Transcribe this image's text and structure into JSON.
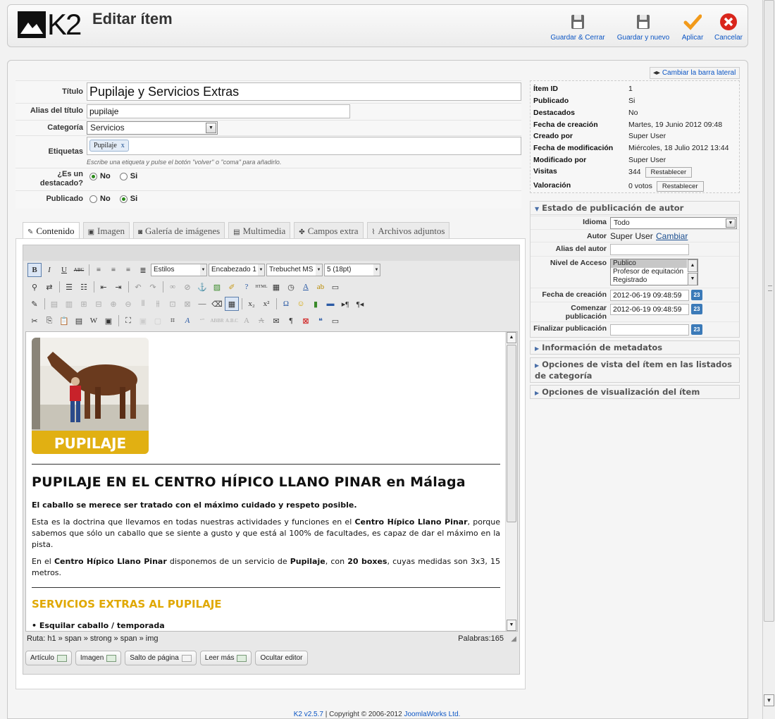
{
  "header": {
    "title": "Editar ítem",
    "logo_text": "K2",
    "buttons": [
      {
        "label": "Guardar & Cerrar",
        "icon": "disk-icon"
      },
      {
        "label": "Guardar y nuevo",
        "icon": "disk-icon"
      },
      {
        "label": "Aplicar",
        "icon": "checkmark-icon"
      },
      {
        "label": "Cancelar",
        "icon": "cancel-x-icon"
      }
    ]
  },
  "form": {
    "titulo_label": "Título",
    "titulo_value": "Pupilaje y Servicios Extras",
    "alias_label": "Alias del título",
    "alias_value": "pupilaje",
    "categoria_label": "Categoría",
    "categoria_value": "Servicios",
    "etiquetas_label": "Etiquetas",
    "tag": "Pupilaje",
    "tag_remove": "x",
    "etiquetas_hint": "Escribe una etiqueta y pulse el botón \"volver\" o \"coma\" para añadirlo.",
    "destacado_label": "¿Es un destacado?",
    "destacado_no": "No",
    "destacado_si": "Si",
    "publicado_label": "Publicado",
    "publicado_no": "No",
    "publicado_si": "Si"
  },
  "tabs": [
    {
      "label": "Contenido",
      "icon": "edit-icon"
    },
    {
      "label": "Imagen",
      "icon": "image-icon"
    },
    {
      "label": "Galería de imágenes",
      "icon": "camera-icon"
    },
    {
      "label": "Multimedia",
      "icon": "film-icon"
    },
    {
      "label": "Campos extra",
      "icon": "puzzle-icon"
    },
    {
      "label": "Archivos adjuntos",
      "icon": "paperclip-icon"
    }
  ],
  "editor": {
    "styles_select": "Estilos",
    "format_select": "Encabezado 1",
    "font_select": "Trebuchet MS",
    "size_select": "5 (18pt)",
    "photo_caption": "PUPILAJE",
    "heading": "PUPILAJE EN EL CENTRO HÍPICO LLANO PINAR en Málaga",
    "p1": "El caballo se merece ser tratado con el máximo cuidado y respeto posible.",
    "p2_a": "Esta es la doctrina que llevamos en todas nuestras actividades y funciones en el ",
    "p2_b": "Centro Hípico Llano Pinar",
    "p2_c": ", porque sabemos que sólo un caballo que se siente a gusto y que está al 100% de facultades, es capaz de dar el máximo en la pista.",
    "p3_a": "En el ",
    "p3_b": "Centro Hípico Llano Pinar",
    "p3_c": " disponemos de un servicio de ",
    "p3_d": "Pupilaje",
    "p3_e": ", con ",
    "p3_f": "20 boxes",
    "p3_g": ", cuyas medidas son 3x3, 15 metros.",
    "h2": "SERVICIOS EXTRAS AL PUPILAJE",
    "li1": "• Esquilar caballo / temporada",
    "path": "Ruta: h1 » span » strong » span » img",
    "words": "Palabras:165",
    "bottom_buttons": [
      "Artículo",
      "Imagen",
      "Salto de página",
      "Leer más",
      "Ocultar editor"
    ]
  },
  "sidebar": {
    "toggle": "Cambiar la barra lateral",
    "meta": [
      {
        "k": "Ítem ID",
        "v": "1"
      },
      {
        "k": "Publicado",
        "v": "Si"
      },
      {
        "k": "Destacados",
        "v": "No"
      },
      {
        "k": "Fecha de creación",
        "v": "Martes, 19 Junio 2012 09:48"
      },
      {
        "k": "Creado por",
        "v": "Super User"
      },
      {
        "k": "Fecha de modificación",
        "v": "Miércoles, 18 Julio 2012 13:44"
      },
      {
        "k": "Modificado por",
        "v": "Super User"
      },
      {
        "k": "Visitas",
        "v": "344"
      },
      {
        "k": "Valoración",
        "v": "0 votos"
      }
    ],
    "reset_label": "Restablecer",
    "pub_title": "Estado de publicación de autor",
    "idioma_label": "Idioma",
    "idioma_value": "Todo",
    "autor_label": "Autor",
    "autor_value": "Super User",
    "cambiar": "Cambiar",
    "alias_autor_label": "Alias del autor",
    "acceso_label": "Nivel de Acceso",
    "acceso_options": [
      "Publico",
      "Profesor de equitación",
      "Registrado"
    ],
    "fecha_creacion_label": "Fecha de creación",
    "fecha_creacion_value": "2012-06-19 09:48:59",
    "comenzar_label": "Comenzar publicación",
    "comenzar_value": "2012-06-19 09:48:59",
    "finalizar_label": "Finalizar publicación",
    "cal_label": "23",
    "sections": [
      "Información de metadatos",
      "Opciones de vista del ítem en las listados de categoría",
      "Opciones de visualización del ítem"
    ]
  },
  "footer": {
    "version": "K2 v2.5.7",
    "copyright": " | Copyright © 2006-2012 ",
    "company": "JoomlaWorks Ltd."
  },
  "colors": {
    "accent": "#0b55c4",
    "heading_yellow": "#e0a800",
    "cancel_red": "#d9261c",
    "apply_orange": "#f29a1a"
  }
}
